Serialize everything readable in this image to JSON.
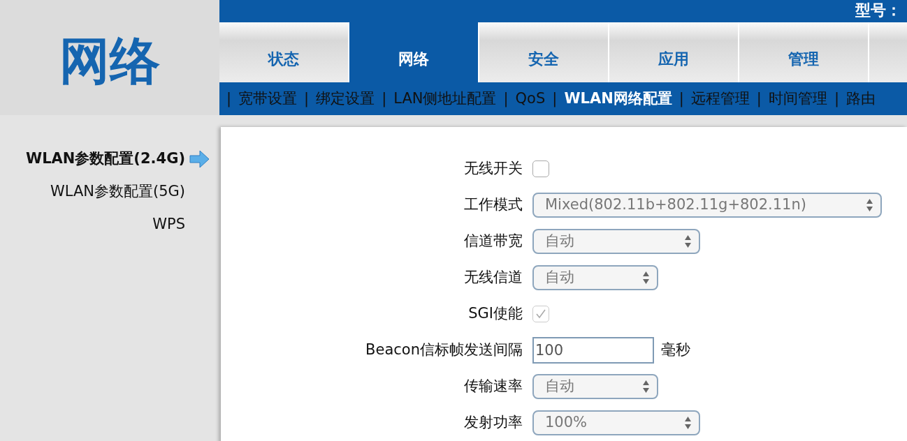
{
  "header": {
    "section_title": "网络",
    "model_label": "型号："
  },
  "tabs": [
    {
      "label": "状态",
      "selected": false
    },
    {
      "label": "网络",
      "selected": true
    },
    {
      "label": "安全",
      "selected": false
    },
    {
      "label": "应用",
      "selected": false
    },
    {
      "label": "管理",
      "selected": false
    },
    {
      "selected": false
    }
  ],
  "subnav": [
    {
      "kind": "separator",
      "text": "|"
    },
    {
      "kind": "link",
      "text": "宽带设置",
      "selected": false
    },
    {
      "kind": "separator",
      "text": "|"
    },
    {
      "kind": "link",
      "text": "绑定设置",
      "selected": false
    },
    {
      "kind": "separator",
      "text": "|"
    },
    {
      "kind": "link",
      "text": "LAN侧地址配置",
      "selected": false
    },
    {
      "kind": "separator",
      "text": "|"
    },
    {
      "kind": "link",
      "text": "QoS",
      "selected": false
    },
    {
      "kind": "separator",
      "text": "|"
    },
    {
      "kind": "link",
      "text": "WLAN网络配置",
      "selected": true
    },
    {
      "kind": "separator",
      "text": "|"
    },
    {
      "kind": "link",
      "text": "远程管理",
      "selected": false
    },
    {
      "kind": "separator",
      "text": "|"
    },
    {
      "kind": "link",
      "text": "时间管理",
      "selected": false
    },
    {
      "kind": "separator",
      "text": "|"
    },
    {
      "kind": "link",
      "text": "路由",
      "selected": false
    }
  ],
  "sidebar": {
    "items": [
      {
        "label": "WLAN参数配置(2.4G)",
        "selected": true
      },
      {
        "label": "WLAN参数配置(5G)",
        "selected": false
      },
      {
        "label": "WPS",
        "selected": false
      }
    ]
  },
  "form": [
    {
      "kind": "checkbox",
      "label": "无线开关",
      "checked": false,
      "disabled": false
    },
    {
      "kind": "select",
      "label": "工作模式",
      "value": "Mixed(802.11b+802.11g+802.11n)",
      "disabled": true
    },
    {
      "kind": "select",
      "label": "信道带宽",
      "value": "自动",
      "disabled": true
    },
    {
      "kind": "select",
      "label": "无线信道",
      "value": "自动",
      "disabled": true
    },
    {
      "kind": "checkbox",
      "label": "SGI使能",
      "checked": true,
      "disabled": true
    },
    {
      "kind": "input",
      "label": "Beacon信标帧发送间隔",
      "value": "100",
      "unit": "毫秒"
    },
    {
      "kind": "select",
      "label": "传输速率",
      "value": "自动",
      "disabled": true
    },
    {
      "kind": "select",
      "label": "发射功率",
      "value": "100%",
      "disabled": true
    }
  ]
}
